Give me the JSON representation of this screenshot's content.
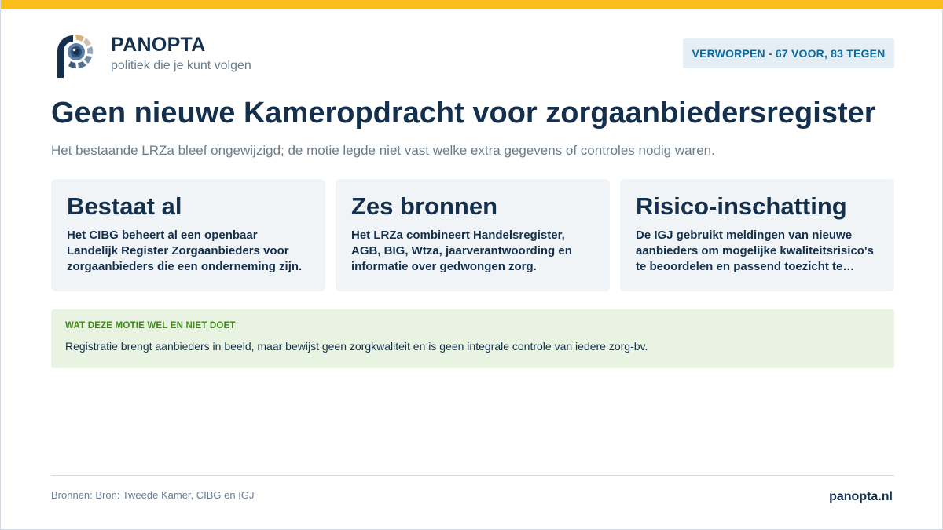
{
  "brand": {
    "name": "PANOPTA",
    "tagline": "politiek die je kunt volgen",
    "logo_icon": "panopta-eye-logo-icon",
    "accent_color": "#fbbd1a",
    "primary_color": "#14304d"
  },
  "status": {
    "label": "VERWORPEN - 67 VOOR, 83 TEGEN",
    "color": "#0e6a99"
  },
  "headline": {
    "title": "Geen nieuwe Kameropdracht voor zorgaanbiedersregister",
    "subtitle": "Het bestaande LRZa bleef ongewijzigd; de motie legde niet vast welke extra gegevens of controles nodig waren."
  },
  "cards": [
    {
      "title": "Bestaat al",
      "text": "Het CIBG beheert al een openbaar Landelijk Register Zorgaanbieders voor zorgaanbieders die een onderneming zijn."
    },
    {
      "title": "Zes bronnen",
      "text": "Het LRZa combineert Handelsregister, AGB, BIG, Wtza, jaarverantwoording en informatie over gedwongen zorg."
    },
    {
      "title": "Risico-inschatting",
      "text": "De IGJ gebruikt meldingen van nieuwe aanbieders om mogelijke kwaliteitsrisico's te beoordelen en passend toezicht te…"
    }
  ],
  "note": {
    "heading": "WAT DEZE MOTIE WEL EN NIET DOET",
    "text": "Registratie brengt aanbieders in beeld, maar bewijst geen zorgkwaliteit en is geen integrale controle van iedere zorg-bv.",
    "color": "#3d8a14"
  },
  "footer": {
    "sources": "Bronnen: Bron: Tweede Kamer, CIBG en IGJ",
    "url": "panopta.nl"
  }
}
